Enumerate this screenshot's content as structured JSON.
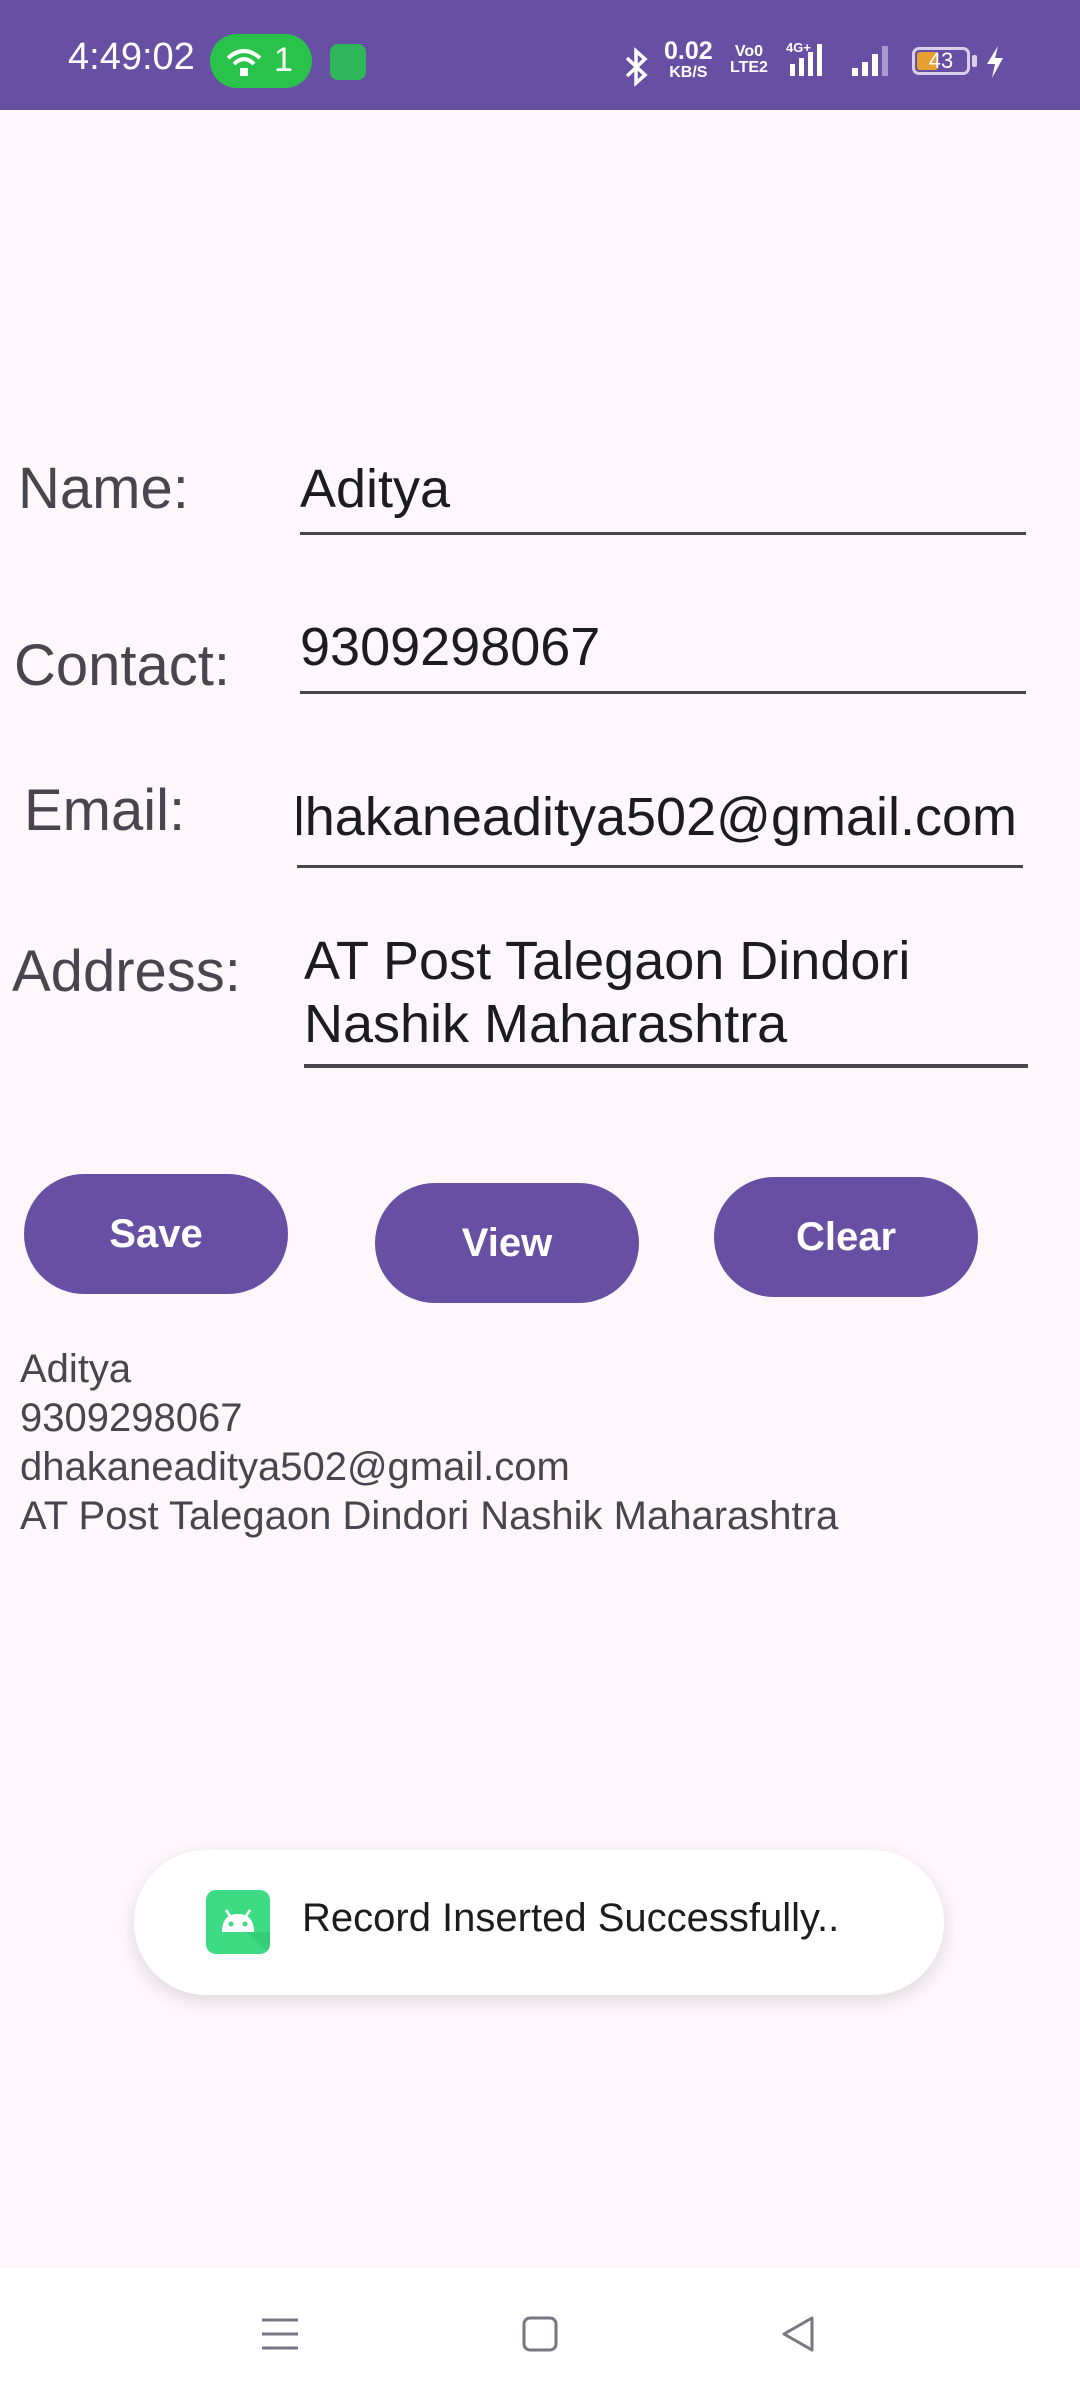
{
  "status_bar": {
    "time": "4:49:02",
    "hotspot_count": "1",
    "net_speed_value": "0.02",
    "net_speed_unit": "KB/S",
    "volte_line1": "Vo0",
    "volte_line2": "LTE2",
    "battery_level": "43",
    "battery_fraction": 0.43,
    "icons": [
      "hotspot-icon",
      "app-notification-icon",
      "bluetooth-icon",
      "signal-4g-icon",
      "signal-icon",
      "battery-icon",
      "charging-icon"
    ]
  },
  "form": {
    "name_label": "Name:",
    "name_value": "Aditya",
    "contact_label": "Contact:",
    "contact_value": "9309298067",
    "email_label": "Email:",
    "email_value": "dhakaneaditya502@gmail.com",
    "address_label": "Address:",
    "address_value": "AT Post Talegaon Dindori Nashik Maharashtra"
  },
  "buttons": {
    "save": "Save",
    "view": "View",
    "clear": "Clear"
  },
  "result": {
    "name": "Aditya",
    "contact": "9309298067",
    "email": "dhakaneaditya502@gmail.com",
    "address": "AT Post Talegaon Dindori Nashik Maharashtra"
  },
  "toast": {
    "message": "Record Inserted Successfully..",
    "icon": "android-app-icon"
  },
  "nav_bar": {
    "icons": [
      "menu-icon",
      "home-icon",
      "back-icon"
    ]
  },
  "colors": {
    "primary": "#6750a4",
    "background": "#fdf7fc",
    "hotspot": "#29c24a",
    "android_green": "#3ddc84"
  }
}
